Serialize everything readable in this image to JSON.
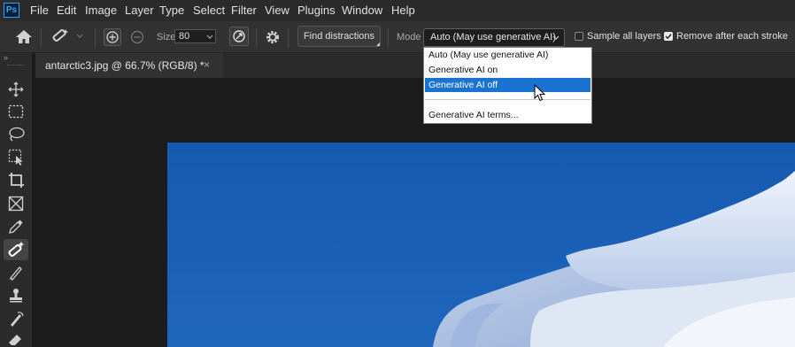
{
  "app": {
    "logo": "Ps"
  },
  "menu": [
    "File",
    "Edit",
    "Image",
    "Layer",
    "Type",
    "Select",
    "Filter",
    "View",
    "Plugins",
    "Window",
    "Help"
  ],
  "options": {
    "size_label": "Size",
    "size_value": "80",
    "find_distractions": "Find distractions",
    "mode_label": "Mode",
    "mode_value": "Auto (May use generative AI)",
    "sample_all_layers": {
      "label": "Sample all layers",
      "checked": false
    },
    "remove_after_stroke": {
      "label": "Remove after each stroke",
      "checked": true
    }
  },
  "document_tab": {
    "label": "antarctic3.jpg @ 66.7% (RGB/8) *",
    "close": "×"
  },
  "mode_dropdown": {
    "options": [
      "Auto (May use generative AI)",
      "Generative AI on",
      "Generative AI off"
    ],
    "highlighted": "Generative AI off",
    "footer": "Generative AI terms..."
  },
  "tools": [
    "move-tool",
    "marquee-tool",
    "lasso-tool",
    "object-selection-tool",
    "crop-tool",
    "frame-tool",
    "eyedropper-tool",
    "remove-tool",
    "brush-tool",
    "stamp-tool",
    "history-brush-tool",
    "eraser-tool"
  ],
  "colors": {
    "accent": "#1a73d0",
    "sky": "#1f5fae",
    "snow": "#e8eef8"
  }
}
